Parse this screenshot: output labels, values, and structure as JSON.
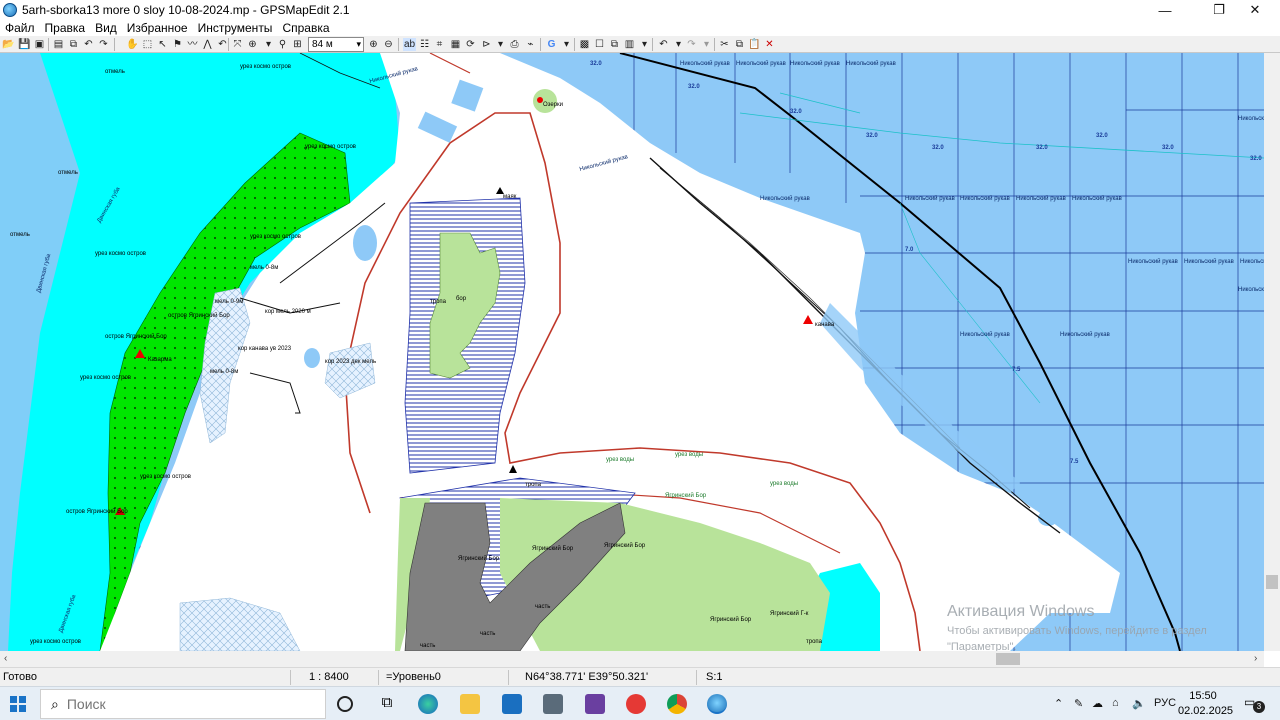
{
  "window": {
    "title": "5arh-sborka13 more 0 sloy 10-08-2024.mp - GPSMapEdit 2.1",
    "minimize": "—",
    "maximize": "❐",
    "close": "✕"
  },
  "menu": [
    "Файл",
    "Правка",
    "Вид",
    "Избранное",
    "Инструменты",
    "Справка"
  ],
  "toolbar": {
    "scale_value": "84 м",
    "icons": [
      "open-icon",
      "save-icon",
      "save-all-icon",
      "properties-icon",
      "copy-icon",
      "undo-icon",
      "redo-icon",
      "hand-icon",
      "zoom-rect-icon",
      "select-icon",
      "pointer-icon",
      "polyline-icon",
      "polygon-icon",
      "edit-nodes-icon",
      "move-icon",
      "zoom-in-icon",
      "zoom-out-icon",
      "label-icon",
      "grid-icon",
      "measure-icon",
      "layers-icon",
      "waypoint-icon",
      "track-icon",
      "route-icon",
      "refresh-icon",
      "google-icon",
      "filter-icon",
      "checkbox-icon",
      "map-icon",
      "undo-arrow-icon",
      "redo-arrow-icon",
      "cut-icon",
      "copy2-icon",
      "paste-icon",
      "delete-icon"
    ]
  },
  "map": {
    "labels": {
      "depth_a": "32.0",
      "depth_b": "7.0",
      "depth_c": "7.5",
      "channel_nikolsky": "Никольский рукав",
      "obstacle": "Озерки",
      "lighthouse": "маяк",
      "canal": "канава",
      "kazarma": "Казарма",
      "shoal_0_8": "мель 0-8м",
      "shoal_0_9": "мель 0-9м",
      "shoal_corp_2020": "кор мель 2020 м",
      "shoal_2023": "кор канава ув 2023",
      "shoal_2023_dec": "кор 2023 дек мель",
      "ostrov_yagrinsky": "остров Ягринский Бор",
      "urez_kosmo": "урез космо остров",
      "otmel": "отмель",
      "dvinskaya": "Двинская губа",
      "yagrinsky_bor": "Ягринский Бор",
      "uchastok": "часть",
      "tropa": "тропа",
      "bor": "бор",
      "urez_vody": "урез воды",
      "yagrinsky_g": "Ягринский Г-к"
    },
    "watermark_line1": "Активация Windows",
    "watermark_line2": "Чтобы активировать Windows, перейдите в раздел",
    "watermark_line3": "\"Параметры\"."
  },
  "status": {
    "ready": "Готово",
    "scale": "1 : 8400",
    "level": "=Уровень0",
    "coords": "N64°38.771' E39°50.321'",
    "s": "S:1"
  },
  "taskbar": {
    "search_placeholder": "Поиск",
    "lang": "РУС",
    "time": "15:50",
    "date": "02.02.2025",
    "notifications": "3"
  },
  "colors": {
    "sea": "#8ec9f7",
    "shallow": "#00ffff",
    "island_green": "#00e600",
    "forest": "#b8e39a",
    "grey_zone": "#808080",
    "hatch": "#2233aa",
    "shore": "#c0392b",
    "road": "#000000"
  }
}
